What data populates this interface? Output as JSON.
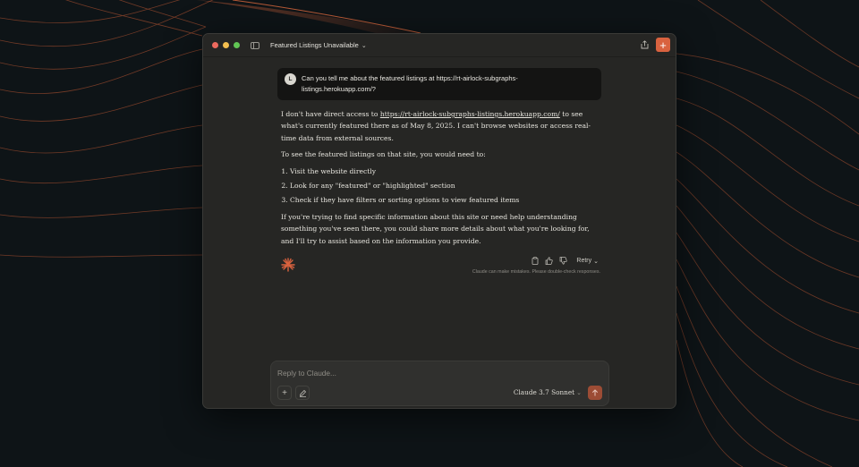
{
  "window": {
    "title": "Featured Listings Unavailable"
  },
  "icons": {
    "sidebar_toggle": "sidebar-icon",
    "share": "share-icon",
    "new_chat": "plus-icon",
    "copy": "copy-icon",
    "thumbs_up": "thumbs-up-icon",
    "thumbs_down": "thumbs-down-icon"
  },
  "colors": {
    "accent": "#d9623f",
    "window_bg": "#262624",
    "user_bubble_bg": "#141413"
  },
  "user_message": {
    "avatar_initial": "L",
    "text": "Can you tell me about the featured listings at https://rt-airlock-subgraphs-listings.herokuapp.com/?"
  },
  "assistant_message": {
    "p1_before_link": "I don't have direct access to ",
    "link": "https://rt-airlock-subgraphs-listings.herokuapp.com/",
    "p1_after_link": " to see what's currently featured there as of May 8, 2025. I can't browse websites or access real-time data from external sources.",
    "p2": "To see the featured listings on that site, you would need to:",
    "steps": [
      "Visit the website directly",
      "Look for any \"featured\" or \"highlighted\" section",
      "Check if they have filters or sorting options to view featured items"
    ],
    "p3": "If you're trying to find specific information about this site or need help understanding something you've seen there, you could share more details about what you're looking for, and I'll try to assist based on the information you provide."
  },
  "actions": {
    "retry_label": "Retry",
    "disclaimer": "Claude can make mistakes. Please double-check responses."
  },
  "composer": {
    "placeholder": "Reply to Claude...",
    "model_label": "Claude 3.7 Sonnet"
  }
}
